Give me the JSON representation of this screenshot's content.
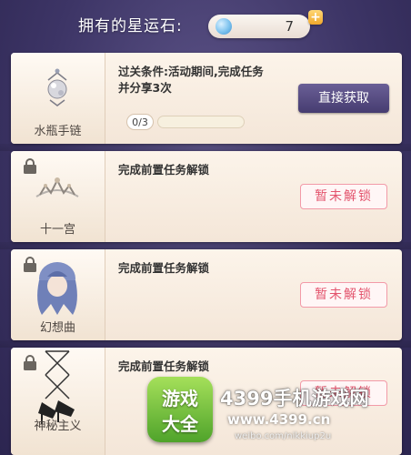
{
  "header": {
    "title": "拥有的星运石:",
    "stone_count": "7",
    "plus_label": "+"
  },
  "tasks": [
    {
      "item_name": "水瓶手链",
      "condition_line1": "过关条件:活动期间,完成任务",
      "condition_line2": "并分享3次",
      "progress_text": "0/3",
      "progress": 0,
      "action_label": "直接获取",
      "locked": false
    },
    {
      "item_name": "十一宫",
      "condition_line1": "完成前置任务解锁",
      "status_label": "暂未解锁",
      "locked": true
    },
    {
      "item_name": "幻想曲",
      "condition_line1": "完成前置任务解锁",
      "status_label": "暂未解锁",
      "locked": true
    },
    {
      "item_name": "神秘主义",
      "condition_line1": "完成前置任务解锁",
      "status_label": "暂未解锁",
      "locked": true
    }
  ],
  "watermark": {
    "logo_line1": "游戏",
    "logo_line2": "大全",
    "site_name": "4399手机游戏网",
    "url": "www.4399.cn",
    "weibo": "weibo.com/nikkiup2u"
  },
  "colors": {
    "background": "#3d3566",
    "button": "#463c70",
    "locked_text": "#e3546d",
    "card": "#fcf4ea"
  }
}
